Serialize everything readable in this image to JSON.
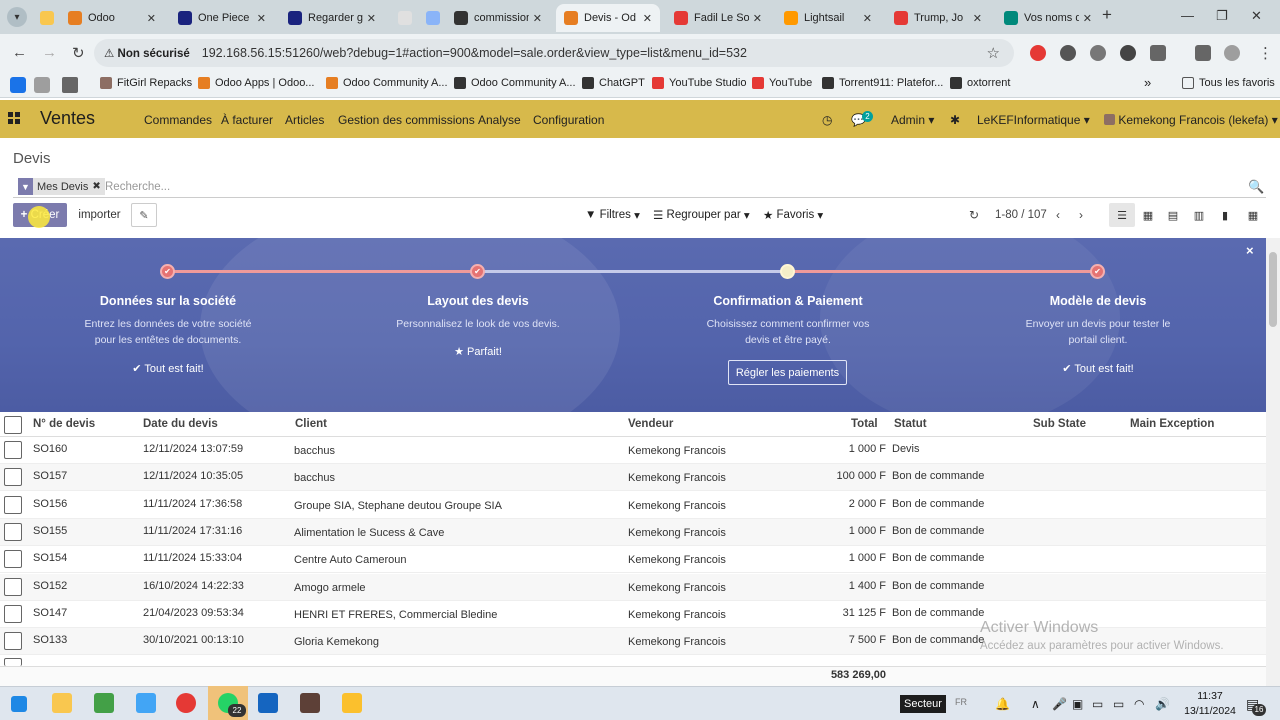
{
  "browser": {
    "tabs": [
      {
        "label": "",
        "color": "#f9c74f"
      },
      {
        "label": "Odoo",
        "color": "#e67e22"
      },
      {
        "label": "One Piece",
        "color": "#1a237e"
      },
      {
        "label": "Regarder g",
        "color": "#1a237e"
      },
      {
        "label": "",
        "color": "#e0e0e0"
      },
      {
        "label": "",
        "color": "#8ab4f8"
      },
      {
        "label": "commission",
        "color": "#333333"
      },
      {
        "label": "Devis - Od",
        "color": "#e67e22"
      },
      {
        "label": "Fadil Le So",
        "color": "#e53935"
      },
      {
        "label": "Lightsail",
        "color": "#ff9900"
      },
      {
        "label": "Trump, Jo",
        "color": "#e53935"
      },
      {
        "label": "Vos noms d",
        "color": "#00897b"
      }
    ],
    "url": {
      "warning": "Non sécurisé",
      "address": "192.168.56.15:51260/web?debug=1#action=900&model=sale.order&view_type=list&menu_id=532"
    },
    "bookmarks": [
      {
        "label": "FitGirl Repacks",
        "color": "#8d6e63"
      },
      {
        "label": "Odoo Apps | Odoo...",
        "color": "#e67e22"
      },
      {
        "label": "Odoo Community A...",
        "color": "#e67e22"
      },
      {
        "label": "Odoo Community A...",
        "color": "#333333"
      },
      {
        "label": "ChatGPT",
        "color": "#333333"
      },
      {
        "label": "YouTube Studio",
        "color": "#e53935"
      },
      {
        "label": "YouTube",
        "color": "#e53935"
      },
      {
        "label": "Torrent911: Platefor...",
        "color": "#333333"
      },
      {
        "label": "oxtorrent",
        "color": "#333333"
      }
    ],
    "all_bookmarks": "Tous les favoris",
    "more": "»"
  },
  "navbar": {
    "app_name": "Ventes",
    "menus": [
      "Commandes",
      "À facturer",
      "Articles",
      "Gestion des commissions",
      "Analyse",
      "Configuration"
    ],
    "chat_count": "2",
    "admin": "Admin",
    "company": "LeKEFInformatique",
    "user": "Kemekong Francois (lekefa)"
  },
  "control_panel": {
    "title": "Devis",
    "facet": "Mes Devis",
    "search_placeholder": "Recherche...",
    "create": "Créer",
    "import": "importer",
    "filters": "Filtres",
    "group_by": "Regrouper par",
    "favorites": "Favoris",
    "pager": "1-80 / 107"
  },
  "onboarding": {
    "steps": [
      {
        "title": "Données sur la société",
        "desc1": "Entrez les données de votre société",
        "desc2": "pour les entêtes de documents.",
        "done": "✔ Tout est fait!"
      },
      {
        "title": "Layout des devis",
        "desc1": "Personnalisez le look de vos devis.",
        "desc2": "",
        "done": "★ Parfait!"
      },
      {
        "title": "Confirmation & Paiement",
        "desc1": "Choisissez comment confirmer vos",
        "desc2": "devis et être payé.",
        "button": "Régler les paiements"
      },
      {
        "title": "Modèle de devis",
        "desc1": "Envoyer un devis pour tester le",
        "desc2": "portail client.",
        "done": "✔ Tout est fait!"
      }
    ]
  },
  "table": {
    "headers": [
      "N° de devis",
      "Date du devis",
      "Client",
      "Vendeur",
      "Total",
      "Statut",
      "Sub State",
      "Main Exception"
    ],
    "rows": [
      {
        "num": "SO160",
        "date": "12/11/2024 13:07:59",
        "client": "bacchus",
        "vendor": "Kemekong Francois",
        "total": "1 000 F",
        "status": "Devis"
      },
      {
        "num": "SO157",
        "date": "12/11/2024 10:35:05",
        "client": "bacchus",
        "vendor": "Kemekong Francois",
        "total": "100 000 F",
        "status": "Bon de commande"
      },
      {
        "num": "SO156",
        "date": "11/11/2024 17:36:58",
        "client": "Groupe SIA, Stephane deutou Groupe SIA",
        "vendor": "Kemekong Francois",
        "total": "2 000 F",
        "status": "Bon de commande"
      },
      {
        "num": "SO155",
        "date": "11/11/2024 17:31:16",
        "client": "Alimentation le Sucess & Cave",
        "vendor": "Kemekong Francois",
        "total": "1 000 F",
        "status": "Bon de commande"
      },
      {
        "num": "SO154",
        "date": "11/11/2024 15:33:04",
        "client": "Centre Auto Cameroun",
        "vendor": "Kemekong Francois",
        "total": "1 000 F",
        "status": "Bon de commande"
      },
      {
        "num": "SO152",
        "date": "16/10/2024 14:22:33",
        "client": "Amogo armele",
        "vendor": "Kemekong Francois",
        "total": "1 400 F",
        "status": "Bon de commande"
      },
      {
        "num": "SO147",
        "date": "21/04/2023 09:53:34",
        "client": "HENRI ET FRERES, Commercial Bledine",
        "vendor": "Kemekong Francois",
        "total": "31 125 F",
        "status": "Bon de commande"
      },
      {
        "num": "SO133",
        "date": "30/10/2021 00:13:10",
        "client": "Gloria Kemekong",
        "vendor": "Kemekong Francois",
        "total": "7 500 F",
        "status": "Bon de commande"
      }
    ],
    "sum_total": "583 269,00"
  },
  "watermark": {
    "line1": "Activer Windows",
    "line2": "Accédez aux paramètres pour activer Windows."
  },
  "taskbar": {
    "whatsapp_count": "22",
    "secteur": "Secteur",
    "lang": "FR",
    "time": "11:37",
    "date": "13/11/2024",
    "notif_count": "16"
  }
}
